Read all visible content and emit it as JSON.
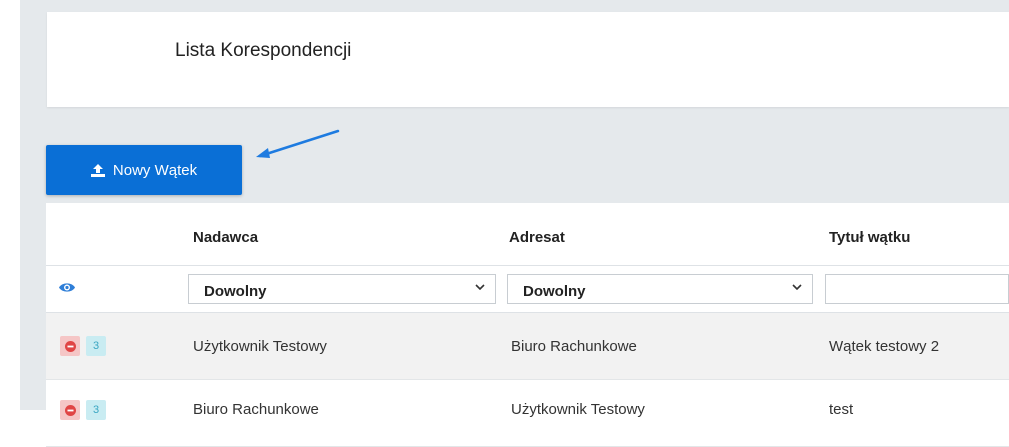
{
  "page": {
    "title": "Lista Korespondencji"
  },
  "toolbar": {
    "new_thread_label": "Nowy Wątek"
  },
  "table": {
    "columns": [
      "Nadawca",
      "Adresat",
      "Tytuł wątku"
    ],
    "filters": {
      "sender": "Dowolny",
      "recipient": "Dowolny",
      "title": ""
    },
    "rows": [
      {
        "count": "3",
        "sender": "Użytkownik Testowy",
        "recipient": "Biuro Rachunkowe",
        "title": "Wątek testowy 2"
      },
      {
        "count": "3",
        "sender": "Biuro Rachunkowe",
        "recipient": "Użytkownik Testowy",
        "title": "test"
      }
    ]
  },
  "colors": {
    "primary": "#0a6fd6",
    "arrow": "#1e7be0",
    "delete_badge": "#f5c6c6",
    "delete_icon": "#e04545",
    "count_badge": "#c9ecf2"
  },
  "icons": {
    "upload": "upload-icon",
    "eye": "eye-icon",
    "delete": "minus-circle-icon"
  }
}
